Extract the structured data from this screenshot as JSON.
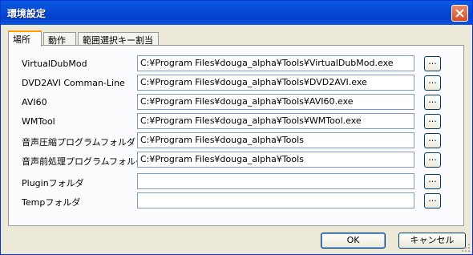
{
  "window": {
    "title": "環境設定"
  },
  "tabs": [
    {
      "label": "場所",
      "active": true
    },
    {
      "label": "動作",
      "active": false
    },
    {
      "label": "範囲選択キー割当",
      "active": false
    }
  ],
  "rows": [
    {
      "label": "VirtualDubMod",
      "value": "C:¥Program Files¥douga_alpha¥Tools¥VirtualDubMod.exe",
      "browse": "..."
    },
    {
      "label": "DVD2AVI Comman-Line",
      "value": "C:¥Program Files¥douga_alpha¥Tools¥DVD2AVI.exe",
      "browse": "..."
    },
    {
      "label": "AVI60",
      "value": "C:¥Program Files¥douga_alpha¥Tools¥AVI60.exe",
      "browse": "..."
    },
    {
      "label": "WMTool",
      "value": "C:¥Program Files¥douga_alpha¥Tools¥WMTool.exe",
      "browse": "..."
    },
    {
      "label": "音声圧縮プログラムフォルダ",
      "value": "C:¥Program Files¥douga_alpha¥Tools",
      "browse": "..."
    },
    {
      "label": "音声前処理プログラムフォルダ",
      "value": "C:¥Program Files¥douga_alpha¥Tools",
      "browse": "..."
    },
    {
      "label": "Pluginフォルダ",
      "value": "",
      "browse": "..."
    },
    {
      "label": "Tempフォルダ",
      "value": "",
      "browse": "..."
    }
  ],
  "buttons": {
    "ok": "OK",
    "cancel": "キャンセル"
  },
  "colors": {
    "titlebar": "#0a5ae0",
    "close": "#d64a25",
    "tab_highlight": "#ff9f00"
  }
}
